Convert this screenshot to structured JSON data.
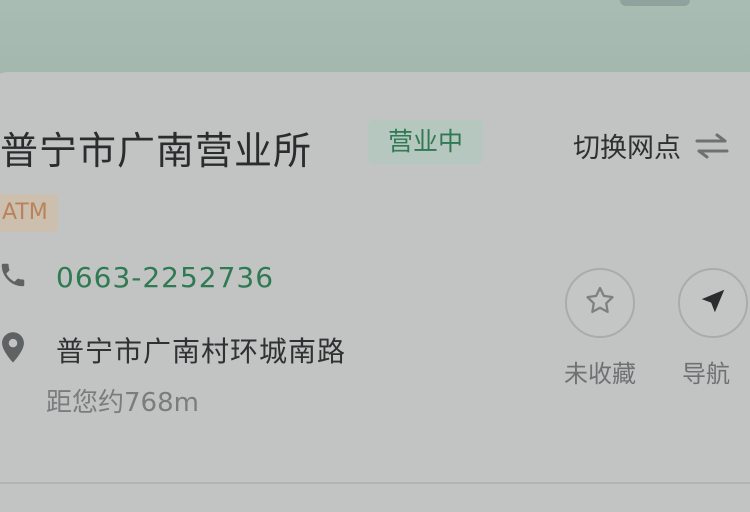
{
  "branch": {
    "name": "普宁市广南营业所",
    "status": "营业中",
    "switch_label": "切换网点",
    "tag": "ATM",
    "phone": "0663-2252736",
    "address": "普宁市广南村环城南路",
    "distance": "距您约768m"
  },
  "actions": {
    "favorite_label": "未收藏",
    "navigate_label": "导航"
  },
  "colors": {
    "accent_green": "#2f7a52",
    "tag_orange": "#b8835a"
  },
  "icons": {
    "swap": "swap-icon",
    "phone": "phone-icon",
    "location": "location-pin-icon",
    "favorite": "star-icon",
    "navigate": "navigation-arrow-icon"
  }
}
